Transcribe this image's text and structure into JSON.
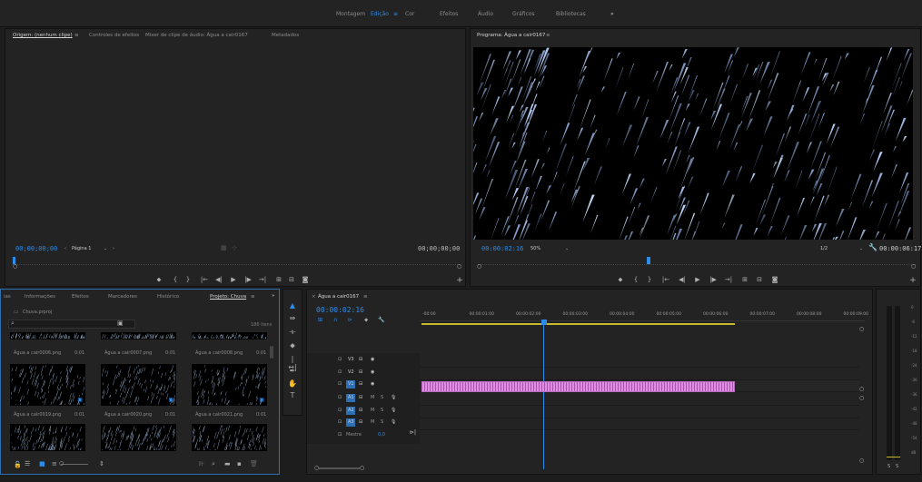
{
  "workspaces": [
    "Montagem",
    "Edição",
    "Cor",
    "Efeitos",
    "Áudio",
    "Gráficos",
    "Bibliotecas"
  ],
  "active_workspace": "Edição",
  "workspace_more": "»",
  "source_monitor": {
    "tabs": [
      "Origem: (nenhum clipe)",
      "Controles de efeitos",
      "Mixer de clipe de áudio: Água a cair0167",
      "Metadados"
    ],
    "tab_menu": "≡",
    "timecode_in": "00;00;00;00",
    "page_label": "Página 1",
    "timecode_out": "00;00;00;00"
  },
  "program_monitor": {
    "title": "Programa: Água a cair0167",
    "tab_menu": "≡",
    "timecode": "00:00:02:16",
    "zoom": "50%",
    "resolution": "1/2",
    "duration": "00:00:06:17"
  },
  "project_panel": {
    "tabs": [
      "ias",
      "Informações",
      "Efeitos",
      "Marcadores",
      "Histórico",
      "Projeto: Chuva"
    ],
    "tab_menu": "≡",
    "more": "»",
    "project_file": "Chuva.prproj",
    "items_count": "186 itens",
    "items": [
      {
        "name": "Água a cair0006.png",
        "duration": "0:01"
      },
      {
        "name": "Água a cair0007.png",
        "duration": "0:01"
      },
      {
        "name": "Água a cair0008.png",
        "duration": "0:01"
      },
      {
        "name": "Água a cair0019.png",
        "duration": "0:01"
      },
      {
        "name": "Água a cair0020.png",
        "duration": "0:01"
      },
      {
        "name": "Água a cair0021.png",
        "duration": "0:01"
      }
    ]
  },
  "timeline": {
    "sequence_name": "Água a cair0167",
    "tab_menu": "≡",
    "timecode": "00:00:02:16",
    "ruler": [
      "-00:00",
      "00:00:01:00",
      "00:00:02:00",
      "00:00:03:00",
      "00:00:04:00",
      "00:00:05:00",
      "00:00:06:00",
      "00:00:07:00",
      "00:00:08:00",
      "00:00:09:00"
    ],
    "video_tracks": [
      "V3",
      "V2",
      "V1"
    ],
    "audio_tracks": [
      "A1",
      "A2",
      "A3"
    ],
    "master_label": "Mestre",
    "master_value": "0,0",
    "track_buttons": [
      "M",
      "S"
    ],
    "clip_color": "#e18be6"
  },
  "audio_meter": {
    "labels": [
      "0",
      "-6",
      "-12",
      "-18",
      "-24",
      "-30",
      "-36",
      "-42",
      "-48",
      "-54",
      "dB"
    ],
    "solo": [
      "S",
      "S"
    ]
  },
  "colors": {
    "accent": "#2d8ceb",
    "panel": "#232323",
    "background": "#1d1d1d",
    "clip": "#e18be6",
    "work_area": "#c8b82e"
  }
}
